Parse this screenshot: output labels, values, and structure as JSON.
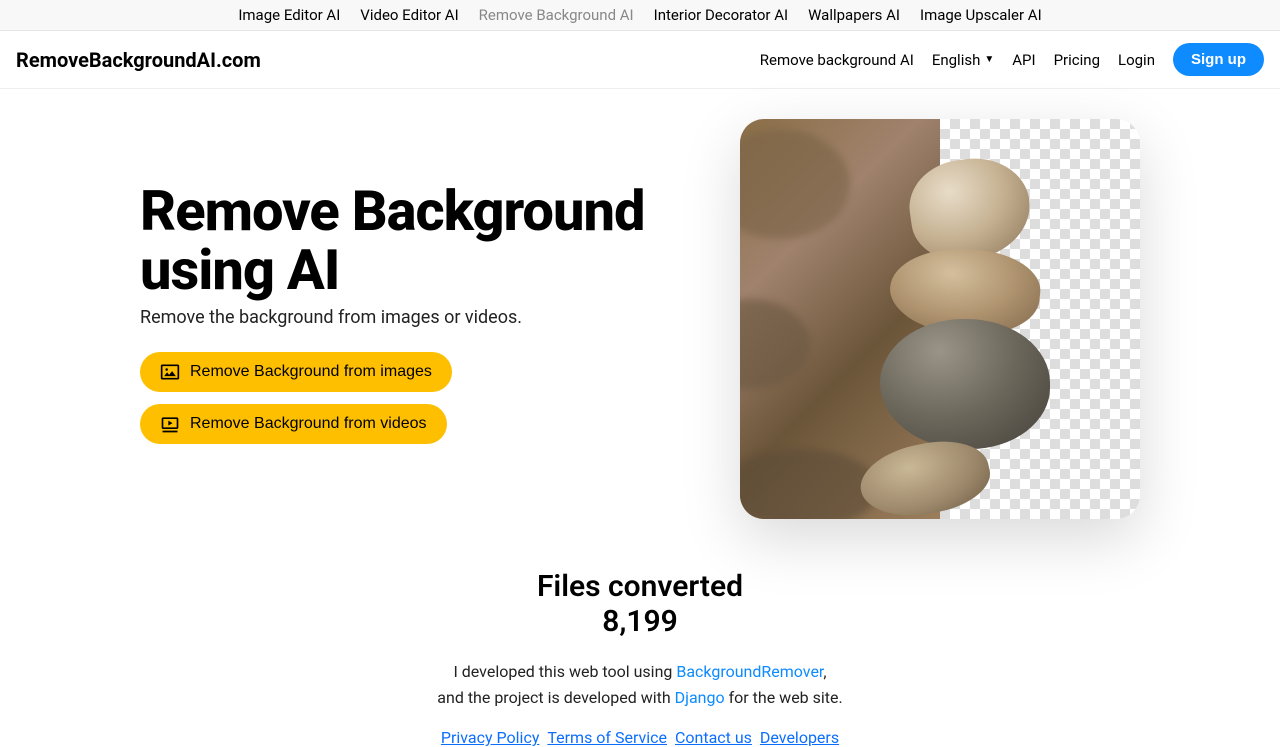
{
  "topnav": {
    "items": [
      {
        "label": "Image Editor AI"
      },
      {
        "label": "Video Editor AI"
      },
      {
        "label": "Remove Background AI"
      },
      {
        "label": "Interior Decorator AI"
      },
      {
        "label": "Wallpapers AI"
      },
      {
        "label": "Image Upscaler AI"
      }
    ],
    "active_index": 2
  },
  "mainnav": {
    "brand": "RemoveBackgroundAI.com",
    "links": {
      "remove_bg": "Remove background AI",
      "language": "English",
      "api": "API",
      "pricing": "Pricing",
      "login": "Login"
    },
    "signup": "Sign up"
  },
  "hero": {
    "title_line1": "Remove Background",
    "title_line2": "using AI",
    "subtitle": "Remove the background from images or videos.",
    "cta_images": "Remove Background from images",
    "cta_videos": "Remove Background from videos"
  },
  "stats": {
    "label": "Files converted",
    "value": "8,199"
  },
  "credits": {
    "text1_a": "I developed this web tool using ",
    "link1": "BackgroundRemover",
    "text1_b": ",",
    "text2_a": "and the project is developed with ",
    "link2": "Django",
    "text2_b": " for the web site."
  },
  "footer": {
    "privacy": "Privacy Policy",
    "terms": "Terms of Service",
    "contact": "Contact us",
    "developers": "Developers"
  }
}
